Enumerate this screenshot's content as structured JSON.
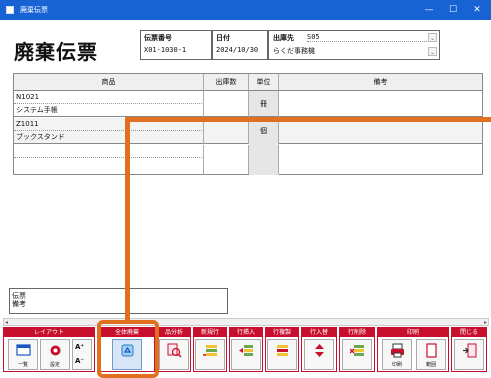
{
  "window": {
    "title": "廃棄伝票"
  },
  "header": {
    "title": "廃棄伝票",
    "slip_no_label": "伝票番号",
    "slip_no": "X01-1030-1",
    "date_label": "日付",
    "date": "2024/10/30",
    "dest_label": "出庫先",
    "dest_code": "S05",
    "dest_name": "らくだ事務機"
  },
  "grid": {
    "columns": [
      "商品",
      "出庫数",
      "単位",
      "備考"
    ],
    "rows": [
      {
        "code": "N1021",
        "name": "システム手帳",
        "qty": "",
        "unit": "冊",
        "note": ""
      },
      {
        "code": "Z1011",
        "name": "ブックスタンド",
        "qty": "",
        "unit": "個",
        "note": ""
      }
    ]
  },
  "memo": {
    "label_line1": "伝票",
    "label_line2": "備考"
  },
  "ribbon": {
    "groups": [
      {
        "label": "レイアウト",
        "buttons": [
          "一覧",
          "設定"
        ]
      },
      {
        "label": "全体廃棄",
        "buttons": [
          ""
        ]
      },
      {
        "label": "品分析",
        "buttons": [
          ""
        ]
      },
      {
        "label": "新規行",
        "buttons": [
          ""
        ]
      },
      {
        "label": "行挿入",
        "buttons": [
          ""
        ]
      },
      {
        "label": "行複製",
        "buttons": [
          ""
        ]
      },
      {
        "label": "行入替",
        "buttons": [
          ""
        ]
      },
      {
        "label": "行削除",
        "buttons": [
          ""
        ]
      },
      {
        "label": "印刷",
        "buttons": [
          "印刷",
          "範囲"
        ]
      },
      {
        "label": "閉じる",
        "buttons": [
          ""
        ]
      }
    ]
  },
  "colors": {
    "titlebar": "#1763d4",
    "ribbon_accent": "#c8102e",
    "highlight": "#e07020"
  }
}
